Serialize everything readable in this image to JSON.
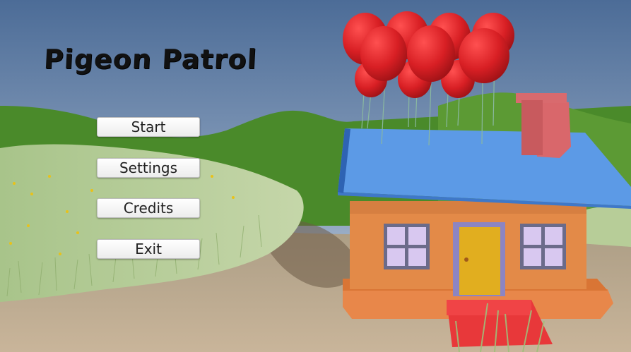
{
  "game": {
    "title": "Pigeon Patrol"
  },
  "menu": {
    "start_label": "Start",
    "settings_label": "Settings",
    "credits_label": "Credits",
    "exit_label": "Exit"
  },
  "colors": {
    "sky_top": "#4f6f9a",
    "sky_bottom": "#b9c6d6",
    "hills": "#4f8a2c",
    "grass": "#b9cf9a",
    "roof": "#5b9be6",
    "wall": "#e08a4a",
    "door": "#e0b020",
    "balloon": "#e0252a",
    "chimney": "#d9676b",
    "steps": "#e33a3a"
  }
}
